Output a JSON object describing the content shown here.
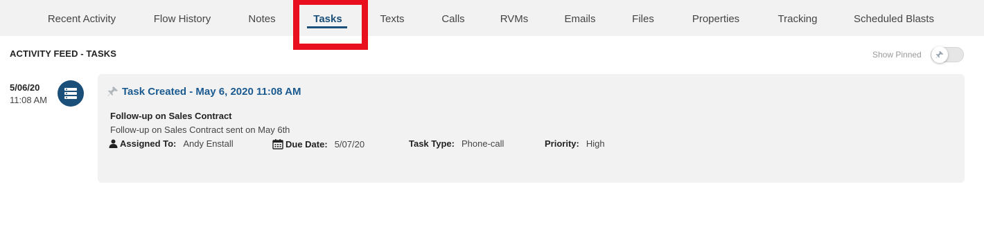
{
  "tabs": [
    {
      "label": "Recent Activity",
      "active": false
    },
    {
      "label": "Flow History",
      "active": false
    },
    {
      "label": "Notes",
      "active": false
    },
    {
      "label": "Tasks",
      "active": true
    },
    {
      "label": "Texts",
      "active": false
    },
    {
      "label": "Calls",
      "active": false
    },
    {
      "label": "RVMs",
      "active": false
    },
    {
      "label": "Emails",
      "active": false
    },
    {
      "label": "Files",
      "active": false
    },
    {
      "label": "Properties",
      "active": false
    },
    {
      "label": "Tracking",
      "active": false
    },
    {
      "label": "Scheduled Blasts",
      "active": false
    }
  ],
  "feed": {
    "title": "ACTIVITY FEED - TASKS",
    "show_pinned_label": "Show Pinned",
    "show_pinned": false
  },
  "entry": {
    "date": "5/06/20",
    "time": "11:08 AM",
    "type_icon": "task-list-icon",
    "title": "Task Created - May 6, 2020 11:08 AM",
    "task_name": "Follow-up on Sales Contract",
    "description": "Follow-up on Sales Contract sent on May 6th",
    "assigned_to_label": "Assigned To:",
    "assigned_to": "Andy Enstall",
    "due_date_label": "Due Date:",
    "due_date": "5/07/20",
    "task_type_label": "Task Type:",
    "task_type": "Phone-call",
    "priority_label": "Priority:",
    "priority": "High"
  },
  "colors": {
    "accent": "#1a4f7a",
    "highlight": "#e8101e",
    "card_bg": "#f2f2f2"
  }
}
